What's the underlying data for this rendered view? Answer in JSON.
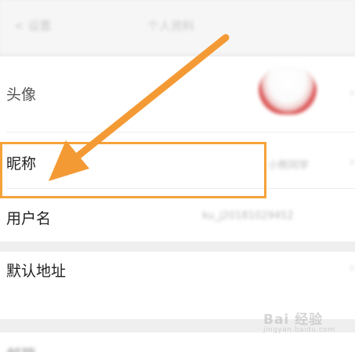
{
  "header": {
    "back_label": "< 设置",
    "title": "个人资料"
  },
  "profile_rows": {
    "avatar_label": "头像",
    "nickname_label": "昵称",
    "nickname_value": "小熊同学",
    "username_label": "用户名",
    "username_value": "ku_j20181029452",
    "address_label": "默认地址",
    "bottom_label": "邮箱"
  },
  "chevron_glyph": "›",
  "annotation": {
    "highlight_color": "#f5a23a",
    "arrow_color": "#f49a35"
  },
  "watermark": {
    "main": "Bai 经验",
    "sub": "jingyan.baidu.com"
  }
}
